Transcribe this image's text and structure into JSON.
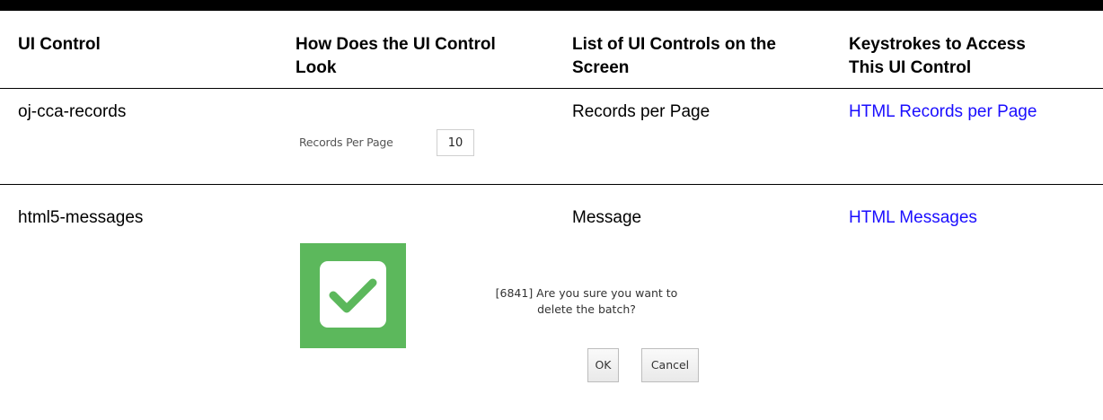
{
  "table": {
    "headers": [
      "UI Control",
      "How Does the UI Control Look",
      "List of UI Controls on the Screen",
      "Keystrokes to Access This UI Control"
    ],
    "header_lines": {
      "col2": [
        "How Does the UI Control",
        "Look"
      ],
      "col3": [
        "List of UI Controls on the",
        "Screen"
      ],
      "col4": [
        "Keystrokes to Access",
        "This UI Control"
      ]
    },
    "rows": [
      {
        "control": "oj-cca-records",
        "list": "Records per Page",
        "keystrokes": "HTML Records per Page",
        "preview": {
          "label": "Records Per Page",
          "value": "10"
        }
      },
      {
        "control": "html5-messages",
        "list": "Message",
        "keystrokes": "HTML Messages",
        "preview": {
          "message_line1": "[6841] Are you sure you want to",
          "message_line2": "delete the batch?",
          "ok_label": "OK",
          "cancel_label": "Cancel"
        }
      }
    ]
  },
  "colors": {
    "link": "#1a0dff",
    "success_icon": "#5cb85c",
    "rule": "#000000"
  },
  "icons": {
    "message_icon": "checkmark-icon"
  }
}
